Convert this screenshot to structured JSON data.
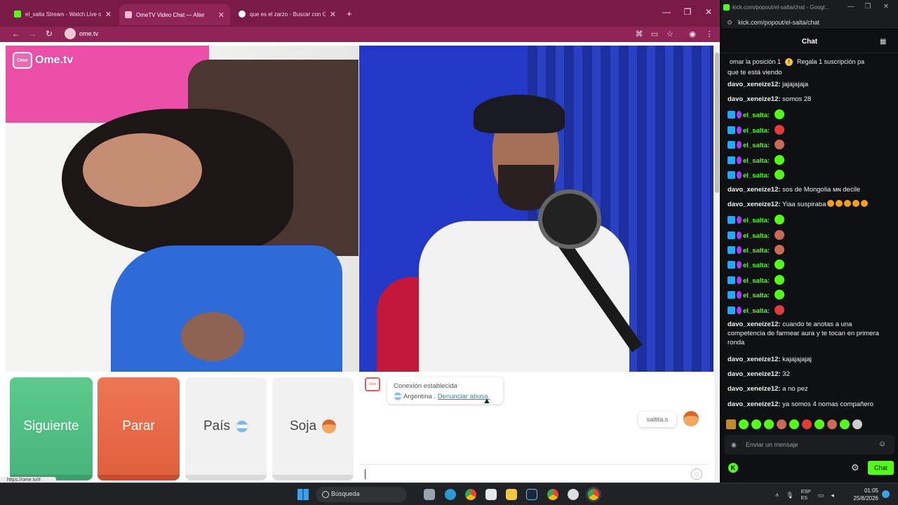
{
  "left_browser": {
    "tabs": [
      {
        "title": "el_salta Stream - Watch Live on",
        "active": false,
        "favicon_color": "#53fc18"
      },
      {
        "title": "OmeTV Video Chat — Alter",
        "active": true,
        "favicon_color": "#f7b7ce"
      },
      {
        "title": "que es el zarzo - Buscar con Go",
        "active": false,
        "favicon_color": "#ffffff"
      }
    ],
    "new_tab": "+",
    "url": "ome.tv",
    "status_link": "https://ome.tv/#"
  },
  "ometv": {
    "logo_text": "Ome.tv",
    "logo_box_text": "Ome",
    "buttons": {
      "next": "Siguiente",
      "stop": "Parar",
      "country": "País",
      "gender": "Soja"
    },
    "system_message": {
      "title": "Conexión establecida",
      "country": "Argentina .",
      "report_link": "Denunciar abuso."
    },
    "my_message": "saltita.s",
    "message_input_placeholder": ""
  },
  "kick": {
    "window_title": "kick.com/popout/el-salta/chat - Googl...",
    "url": "kick.com/popout/el-salta/chat",
    "header": "Chat",
    "pinned": [
      "omar la posición 1",
      "Regala 1 suscripción pa"
    ],
    "messages": [
      {
        "user": "",
        "text": "que te está viendo",
        "emotes": []
      },
      {
        "user": "davo_xeneize12:",
        "text": "jajajajaja",
        "emotes": []
      },
      {
        "user": "davo_xeneize12:",
        "text": "somos 28",
        "emotes": []
      },
      {
        "user": "el_salta:",
        "text": "",
        "emotes": [
          "g"
        ]
      },
      {
        "user": "el_salta:",
        "text": "",
        "emotes": [
          "r"
        ]
      },
      {
        "user": "el_salta:",
        "text": "",
        "emotes": [
          "p"
        ]
      },
      {
        "user": "el_salta:",
        "text": "",
        "emotes": [
          "g"
        ]
      },
      {
        "user": "el_salta:",
        "text": "",
        "emotes": [
          "g"
        ]
      },
      {
        "user": "davo_xeneize12:",
        "text": "sos de Mongolia ᴍɴ decile",
        "emotes": []
      },
      {
        "user": "davo_xeneize12:",
        "text": "Yiaa suspiraba",
        "emotes": [
          "y",
          "y",
          "y",
          "y",
          "y"
        ]
      },
      {
        "user": "el_salta:",
        "text": "",
        "emotes": [
          "g"
        ]
      },
      {
        "user": "el_salta:",
        "text": "",
        "emotes": [
          "p"
        ]
      },
      {
        "user": "el_salta:",
        "text": "",
        "emotes": [
          "p"
        ]
      },
      {
        "user": "el_salta:",
        "text": "",
        "emotes": [
          "g"
        ]
      },
      {
        "user": "el_salta:",
        "text": "",
        "emotes": [
          "g"
        ]
      },
      {
        "user": "el_salta:",
        "text": "",
        "emotes": [
          "g"
        ]
      },
      {
        "user": "el_salta:",
        "text": "",
        "emotes": [
          "r"
        ]
      },
      {
        "user": "davo_xeneize12:",
        "text": "cuando te anotas a una competencia de farmear aura y te tocan en primera ronda",
        "emotes": []
      },
      {
        "user": "davo_xeneize12:",
        "text": "kajajajajaj",
        "emotes": []
      },
      {
        "user": "davo_xeneize12:",
        "text": "32",
        "emotes": []
      },
      {
        "user": "davo_xeneize12:",
        "text": "a no pez",
        "emotes": []
      },
      {
        "user": "davo_xeneize12:",
        "text": "ya somos 4 nomas compañero",
        "emotes": []
      }
    ],
    "input_placeholder": "Enviar un mensaje",
    "chat_button": "Chat",
    "accent": "#53fc18"
  },
  "taskbar": {
    "search": "Búsqueda",
    "lang": "ESP",
    "lang2": "ES",
    "time": "01:05",
    "date": "25/8/2026"
  }
}
